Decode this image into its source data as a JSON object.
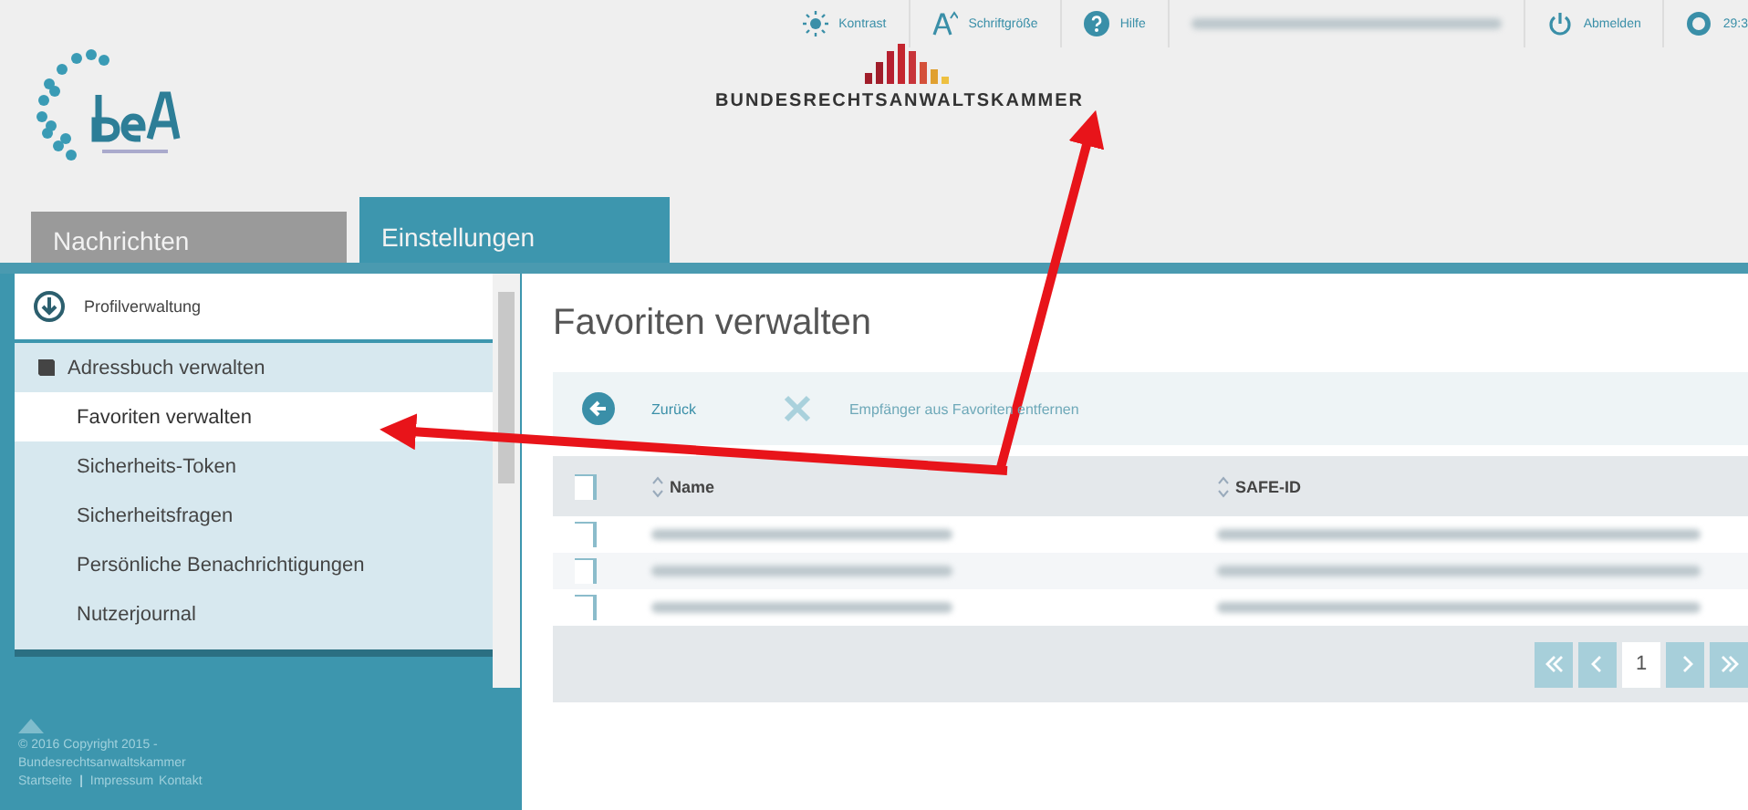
{
  "header": {
    "tools": [
      {
        "kind": "contrast",
        "label": "Kontrast"
      },
      {
        "kind": "fontsize",
        "label": "Schriftgröße"
      },
      {
        "kind": "help",
        "label": "Hilfe"
      },
      {
        "kind": "user"
      },
      {
        "kind": "logout",
        "label": "Abmelden"
      },
      {
        "kind": "timer",
        "label": "29:3"
      }
    ],
    "org_name": "BUNDESRECHTSANWALTSKAMMER"
  },
  "tabs": [
    {
      "label": "Nachrichten",
      "selected": false
    },
    {
      "label": "Einstellungen",
      "selected": true
    }
  ],
  "sidebar": {
    "section": "Profilverwaltung",
    "items": [
      {
        "label": "Adressbuch verwalten",
        "kind": "group",
        "selected": false
      },
      {
        "label": "Favoriten verwalten",
        "kind": "item",
        "selected": true
      },
      {
        "label": "Sicherheits-Token",
        "kind": "item",
        "selected": false
      },
      {
        "label": "Sicherheitsfragen",
        "kind": "item",
        "selected": false
      },
      {
        "label": "Persönliche Benachrichtigungen",
        "kind": "item",
        "selected": false
      },
      {
        "label": "Nutzerjournal",
        "kind": "item",
        "selected": false
      }
    ]
  },
  "footer": {
    "copyright": "© 2016 Copyright 2015 -",
    "org": "Bundesrechtsanwaltskammer",
    "links": [
      {
        "kind": "link",
        "label": "Startseite"
      },
      {
        "kind": "separator",
        "label": "|"
      },
      {
        "kind": "link",
        "label": "Impressum"
      },
      {
        "kind": "link",
        "label": "Kontakt"
      }
    ]
  },
  "page_title": "Favoriten verwalten",
  "toolbar": [
    {
      "kind": "back",
      "label": "Zurück",
      "disabled": false
    },
    {
      "kind": "remove",
      "label": "Empfänger aus Favoriten entfernen",
      "disabled": true
    }
  ],
  "table": {
    "select_all": {
      "checked": false
    },
    "columns": [
      "Name",
      "SAFE-ID"
    ],
    "rows": [
      {
        "checked": false
      },
      {
        "checked": false
      },
      {
        "checked": false
      }
    ]
  },
  "pagination": {
    "pages": [
      {
        "label": "1",
        "selected": true
      }
    ]
  }
}
